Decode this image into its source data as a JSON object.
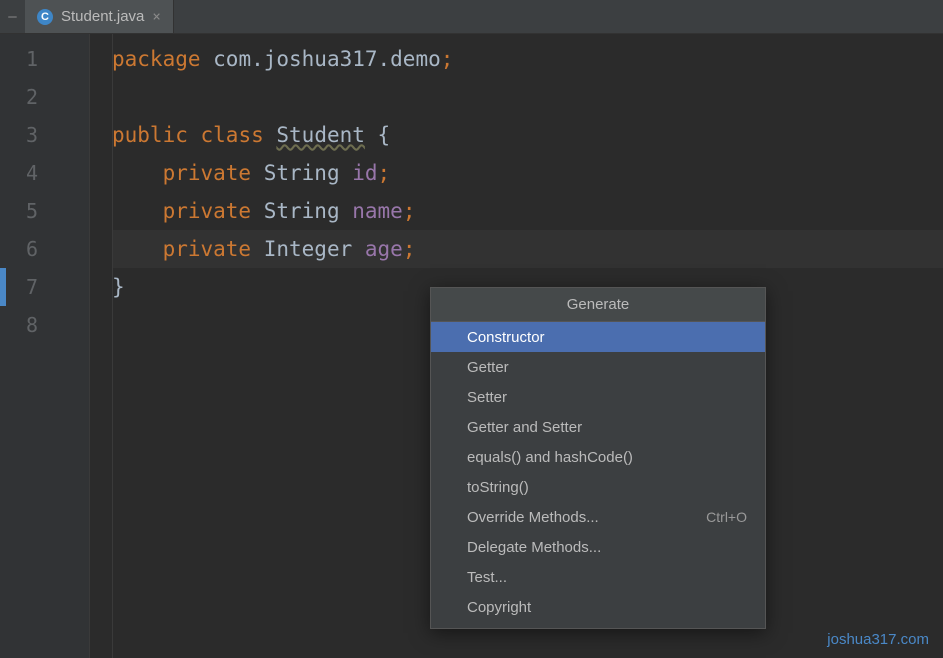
{
  "tab": {
    "icon_letter": "C",
    "filename": "Student.java",
    "close_glyph": "×"
  },
  "gutter": {
    "lines": [
      "1",
      "2",
      "3",
      "4",
      "5",
      "6",
      "7",
      "8"
    ],
    "active_index": 6
  },
  "code": {
    "l1": {
      "kw": "package",
      "rest": " com.joshua317.demo",
      "semi": ";"
    },
    "l3": {
      "kw1": "public",
      "kw2": "class",
      "name": "Student",
      "brace": " {"
    },
    "l4": {
      "indent": "    ",
      "kw": "private",
      "type": " String ",
      "field": "id",
      "semi": ";"
    },
    "l5": {
      "indent": "    ",
      "kw": "private",
      "type": " String ",
      "field": "name",
      "semi": ";"
    },
    "l6": {
      "indent": "    ",
      "kw": "private",
      "type": " Integer ",
      "field": "age",
      "semi": ";"
    },
    "l7": {
      "brace": "}"
    }
  },
  "popup": {
    "title": "Generate",
    "items": [
      {
        "label": "Constructor",
        "shortcut": "",
        "selected": true
      },
      {
        "label": "Getter",
        "shortcut": ""
      },
      {
        "label": "Setter",
        "shortcut": ""
      },
      {
        "label": "Getter and Setter",
        "shortcut": ""
      },
      {
        "label": "equals() and hashCode()",
        "shortcut": ""
      },
      {
        "label": "toString()",
        "shortcut": ""
      },
      {
        "label": "Override Methods...",
        "shortcut": "Ctrl+O"
      },
      {
        "label": "Delegate Methods...",
        "shortcut": ""
      },
      {
        "label": "Test...",
        "shortcut": ""
      },
      {
        "label": "Copyright",
        "shortcut": ""
      }
    ]
  },
  "watermark": "joshua317.com",
  "tab_lead_glyph": "—"
}
